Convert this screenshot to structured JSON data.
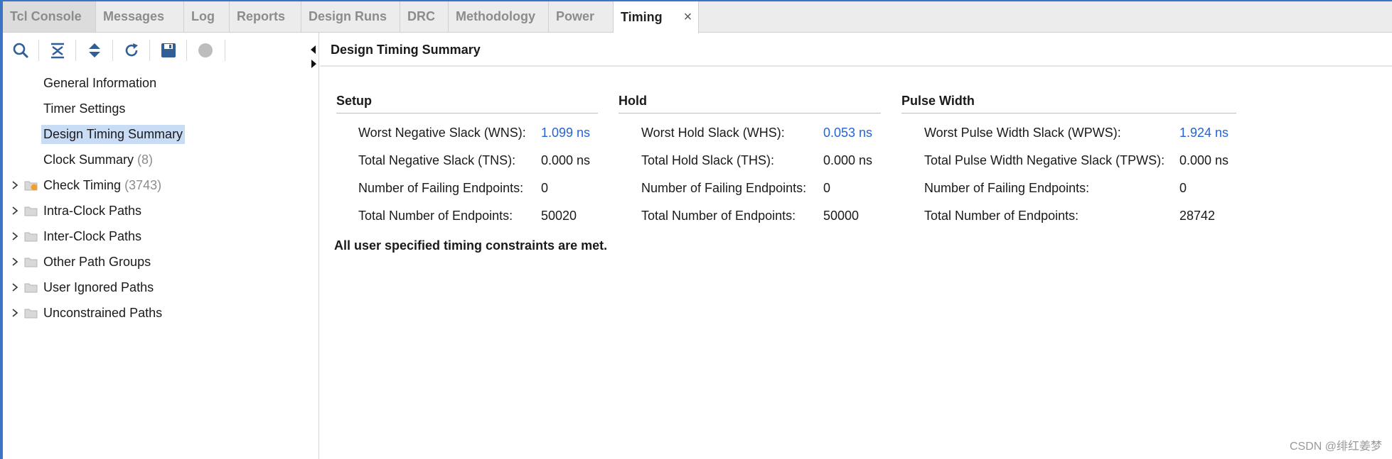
{
  "tabs": [
    {
      "label": "Tcl Console"
    },
    {
      "label": "Messages"
    },
    {
      "label": "Log"
    },
    {
      "label": "Reports"
    },
    {
      "label": "Design Runs"
    },
    {
      "label": "DRC"
    },
    {
      "label": "Methodology"
    },
    {
      "label": "Power"
    },
    {
      "label": "Timing",
      "active": true
    }
  ],
  "tab_close_glyph": "×",
  "toolbar": {
    "icons": [
      "search-icon",
      "collapse-all-icon",
      "expand-all-icon",
      "refresh-icon",
      "save-icon",
      "stop-icon"
    ]
  },
  "tree": {
    "items": [
      {
        "label": "General Information",
        "count": ""
      },
      {
        "label": "Timer Settings",
        "count": ""
      },
      {
        "label": "Design Timing Summary",
        "count": "",
        "selected": true
      },
      {
        "label": "Clock Summary",
        "count": "(8)"
      },
      {
        "label": "Check Timing",
        "count": "(3743)",
        "expandable": true,
        "icon": "folder-warning-icon"
      },
      {
        "label": "Intra-Clock Paths",
        "count": "",
        "expandable": true,
        "icon": "folder-icon"
      },
      {
        "label": "Inter-Clock Paths",
        "count": "",
        "expandable": true,
        "icon": "folder-icon"
      },
      {
        "label": "Other Path Groups",
        "count": "",
        "expandable": true,
        "icon": "folder-icon"
      },
      {
        "label": "User Ignored Paths",
        "count": "",
        "expandable": true,
        "icon": "folder-icon"
      },
      {
        "label": "Unconstrained Paths",
        "count": "",
        "expandable": true,
        "icon": "folder-icon"
      }
    ]
  },
  "main": {
    "title": "Design Timing Summary",
    "sections": {
      "setup": {
        "header": "Setup",
        "rows": [
          {
            "label": "Worst Negative Slack (WNS):",
            "value": "1.099 ns"
          },
          {
            "label": "Total Negative Slack (TNS):",
            "value": "0.000 ns"
          },
          {
            "label": "Number of Failing Endpoints:",
            "value": "0"
          },
          {
            "label": "Total Number of Endpoints:",
            "value": "50020"
          }
        ]
      },
      "hold": {
        "header": "Hold",
        "rows": [
          {
            "label": "Worst Hold Slack (WHS):",
            "value": "0.053 ns"
          },
          {
            "label": "Total Hold Slack (THS):",
            "value": "0.000 ns"
          },
          {
            "label": "Number of Failing Endpoints:",
            "value": "0"
          },
          {
            "label": "Total Number of Endpoints:",
            "value": "50000"
          }
        ]
      },
      "pulse": {
        "header": "Pulse Width",
        "rows": [
          {
            "label": "Worst Pulse Width Slack (WPWS):",
            "value": "1.924 ns"
          },
          {
            "label": "Total Pulse Width Negative Slack (TPWS):",
            "value": "0.000 ns"
          },
          {
            "label": "Number of Failing Endpoints:",
            "value": "0"
          },
          {
            "label": "Total Number of Endpoints:",
            "value": "28742"
          }
        ]
      }
    },
    "status": "All user specified timing constraints are met."
  },
  "watermark": "CSDN @绯红姜梦",
  "colors": {
    "accent": "#3b73c5",
    "link": "#2563d9",
    "selection": "#c9dcf5"
  }
}
